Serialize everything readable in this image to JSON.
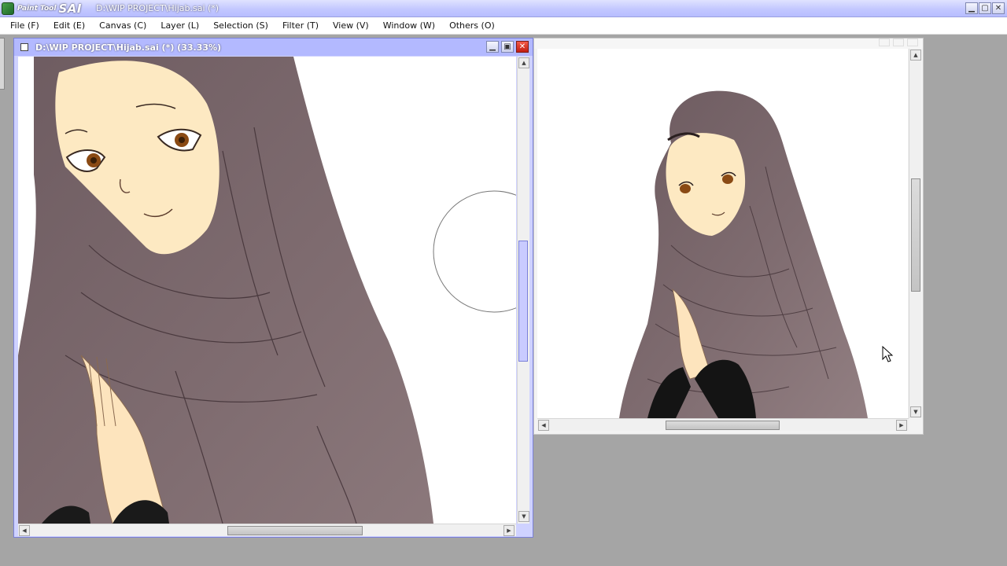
{
  "app": {
    "logo_small": "Paint Tool",
    "logo_big": "SAI",
    "title": "D:\\WIP PROJECT\\Hijab.sai (*)",
    "window_controls": {
      "minimize": "▁",
      "maximize": "▢",
      "close": "✕"
    }
  },
  "menu": [
    "File (F)",
    "Edit (E)",
    "Canvas (C)",
    "Layer (L)",
    "Selection (S)",
    "Filter (T)",
    "View (V)",
    "Window (W)",
    "Others (O)"
  ],
  "canvas_window": {
    "title": "D:\\WIP PROJECT\\Hijab.sai (*) (33.33%)",
    "controls": {
      "minimize": "▁",
      "maximize": "▣",
      "close": "✕"
    },
    "scroll_arrows": {
      "up": "▲",
      "down": "▼",
      "left": "◀",
      "right": "▶"
    }
  },
  "navigator_window": {
    "scroll_arrows": {
      "up": "▲",
      "down": "▼",
      "left": "◀",
      "right": "▶"
    }
  },
  "colors": {
    "title_accent": "#b3b9ff",
    "hijab": "#7f6c70",
    "skin": "#fde9c2",
    "background": "#a5a5a5"
  },
  "icons": [
    "app-logo-icon",
    "document-icon",
    "minimize-icon",
    "maximize-icon",
    "close-icon",
    "brush-cursor-icon",
    "mouse-pointer-icon"
  ]
}
